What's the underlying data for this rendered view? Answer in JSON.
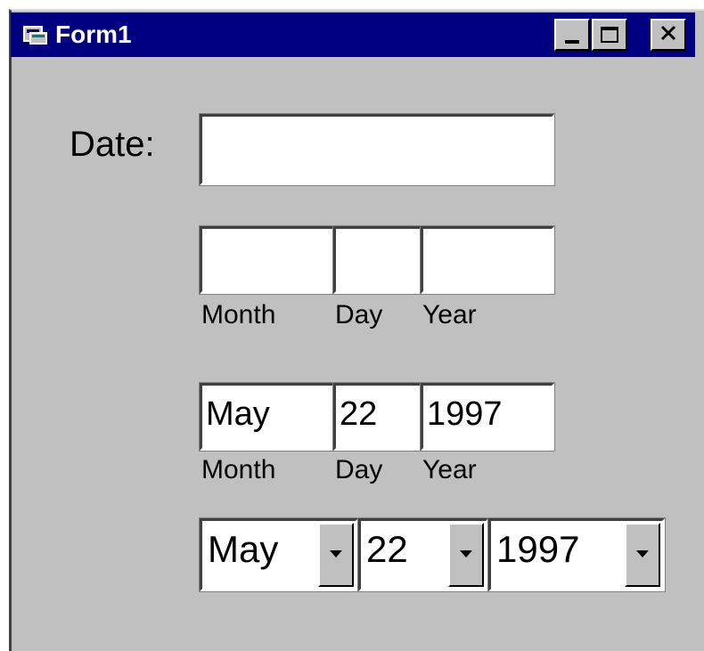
{
  "window": {
    "title": "Form1",
    "buttons": {
      "minimize": "_",
      "maximize": "□",
      "close": "X"
    }
  },
  "date_field": {
    "label": "Date:",
    "value": ""
  },
  "split_empty": {
    "month": "",
    "day": "",
    "year": "",
    "labels": {
      "month": "Month",
      "day": "Day",
      "year": "Year"
    }
  },
  "split_filled": {
    "month": "May",
    "day": "22",
    "year": "1997",
    "labels": {
      "month": "Month",
      "day": "Day",
      "year": "Year"
    }
  },
  "combos": {
    "month": "May",
    "day": "22",
    "year": "1997"
  },
  "colors": {
    "face": "#c0c0c0",
    "titlebar": "#000080",
    "field": "#ffffff"
  },
  "icons": {
    "app": "app-window-icon",
    "dropdown": "chevron-down-icon"
  }
}
